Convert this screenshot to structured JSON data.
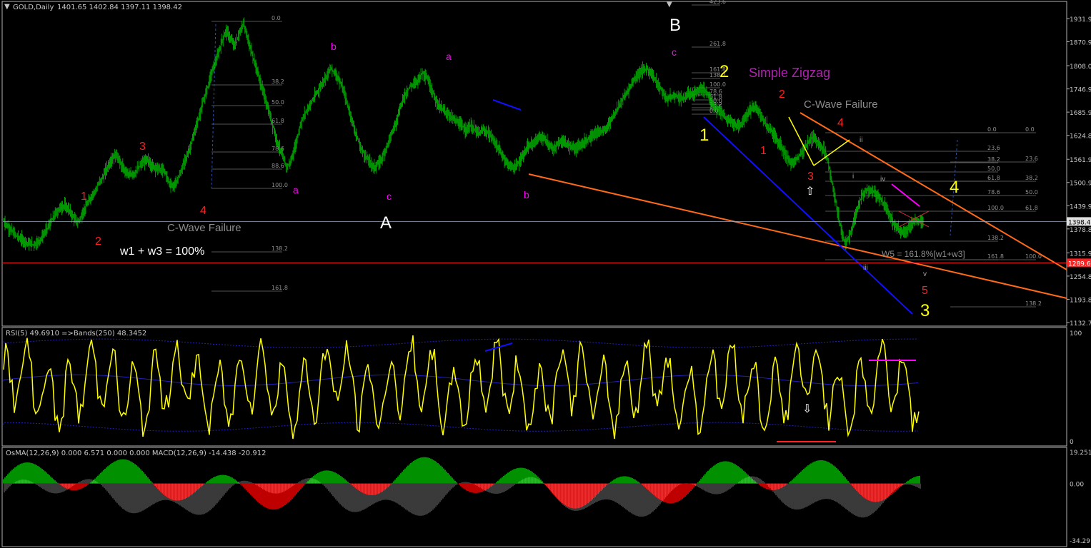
{
  "header": {
    "symbol": "GOLD,Daily",
    "ohlc": "1401.65 1402.84 1397.11 1398.42"
  },
  "colors": {
    "background": "#000000",
    "candles": "#00c000",
    "rsi_line": "#ffff00",
    "macd_signal": "#c0c0c0",
    "osma_up": "#00c000",
    "osma_down": "#ff0000",
    "wave_red": "#ff2020",
    "wave_yellow": "#ffff00",
    "wave_magenta": "#ff00ff",
    "wave_white": "#ffffff",
    "channel_orange": "#ff6a1a",
    "channel_blue": "#1010ff",
    "fib_lines": "#707070"
  },
  "chart_data": [
    {
      "type": "candlestick",
      "panel": "price",
      "y_ticks": [
        "1931.9",
        "1870.9",
        "1808.0",
        "1746.9",
        "1685.9",
        "1624.8",
        "1561.9",
        "1500.9",
        "1439.9",
        "1378.8",
        "1315.9",
        "1254.8",
        "1193.8",
        "1132.7"
      ],
      "ylim": [
        1110,
        1960
      ],
      "current_price": "1398.4",
      "horizontal_line_value": "1289.6",
      "close_series": [
        1400,
        1385,
        1372,
        1360,
        1352,
        1345,
        1340,
        1338,
        1345,
        1360,
        1380,
        1400,
        1420,
        1435,
        1440,
        1430,
        1410,
        1395,
        1415,
        1440,
        1460,
        1480,
        1500,
        1520,
        1545,
        1565,
        1575,
        1545,
        1530,
        1520,
        1525,
        1540,
        1555,
        1560,
        1545,
        1540,
        1535,
        1530,
        1500,
        1490,
        1510,
        1540,
        1570,
        1600,
        1640,
        1680,
        1720,
        1760,
        1800,
        1830,
        1870,
        1900,
        1880,
        1860,
        1890,
        1920,
        1880,
        1840,
        1800,
        1760,
        1720,
        1680,
        1640,
        1600,
        1570,
        1540,
        1560,
        1600,
        1650,
        1680,
        1700,
        1720,
        1740,
        1760,
        1780,
        1800,
        1790,
        1770,
        1740,
        1700,
        1660,
        1620,
        1590,
        1570,
        1555,
        1540,
        1550,
        1570,
        1600,
        1630,
        1660,
        1700,
        1730,
        1750,
        1760,
        1770,
        1790,
        1780,
        1750,
        1720,
        1700,
        1690,
        1680,
        1670,
        1660,
        1650,
        1640,
        1650,
        1640,
        1630,
        1640,
        1630,
        1620,
        1600,
        1580,
        1560,
        1545,
        1540,
        1550,
        1570,
        1590,
        1600,
        1610,
        1620,
        1615,
        1600,
        1590,
        1600,
        1610,
        1605,
        1595,
        1590,
        1600,
        1605,
        1615,
        1625,
        1630,
        1635,
        1640,
        1660,
        1680,
        1700,
        1720,
        1740,
        1760,
        1780,
        1790,
        1800,
        1795,
        1780,
        1760,
        1740,
        1720,
        1725,
        1730,
        1725,
        1720,
        1735,
        1730,
        1740,
        1745,
        1740,
        1720,
        1700,
        1690,
        1680,
        1665,
        1660,
        1650,
        1655,
        1670,
        1690,
        1700,
        1690,
        1670,
        1650,
        1640,
        1620,
        1600,
        1580,
        1560,
        1550,
        1565,
        1580,
        1600,
        1615,
        1620,
        1600,
        1590,
        1560,
        1500,
        1440,
        1380,
        1340,
        1360,
        1400,
        1440,
        1470,
        1480,
        1480,
        1470,
        1460,
        1440,
        1420,
        1395,
        1380,
        1370,
        1375,
        1390,
        1400,
        1398
      ],
      "wave_labels": [
        {
          "text": "1",
          "color": "red"
        },
        {
          "text": "2",
          "color": "red"
        },
        {
          "text": "3",
          "color": "red"
        },
        {
          "text": "4",
          "color": "red"
        },
        {
          "text": "a",
          "color": "magenta"
        },
        {
          "text": "b",
          "color": "magenta"
        },
        {
          "text": "c",
          "color": "magenta"
        },
        {
          "text": "a",
          "color": "magenta"
        },
        {
          "text": "b",
          "color": "magenta"
        },
        {
          "text": "c",
          "color": "magenta"
        },
        {
          "text": "A",
          "color": "white"
        },
        {
          "text": "B",
          "color": "white"
        },
        {
          "text": "1",
          "color": "yellow"
        },
        {
          "text": "2",
          "color": "yellow"
        },
        {
          "text": "3",
          "color": "yellow"
        },
        {
          "text": "4",
          "color": "yellow"
        },
        {
          "text": "1",
          "color": "red"
        },
        {
          "text": "2",
          "color": "red"
        },
        {
          "text": "3",
          "color": "red"
        },
        {
          "text": "4",
          "color": "red"
        },
        {
          "text": "5",
          "color": "red"
        },
        {
          "text": "i",
          "color": "gray"
        },
        {
          "text": "ii",
          "color": "gray"
        },
        {
          "text": "iii",
          "color": "gray"
        },
        {
          "text": "iv",
          "color": "gray"
        },
        {
          "text": "v",
          "color": "gray"
        }
      ],
      "annotations": {
        "c_wave_failure_1": "C-Wave Failure",
        "w1_w3": "w1 + w3 = 100%",
        "simple_zigzag": "Simple Zigzag",
        "c_wave_failure_2": "C-Wave Failure",
        "w5": "W5 = 161.8%[w1+w3]"
      },
      "fib_levels_left": [
        "0.0",
        "38.2",
        "50.0",
        "61.8",
        "78.6",
        "88.6",
        "100.0",
        "138.2",
        "161.8"
      ],
      "fib_levels_center": [
        "423.6",
        "261.8",
        "161.8",
        "138.2",
        "100.0",
        "78.6",
        "61.8",
        "50.0",
        "38.2",
        "23.6",
        "0.0"
      ],
      "fib_levels_right_a": [
        "0.0",
        "23.6",
        "38.2",
        "50.0",
        "61.8",
        "78.6",
        "100.0",
        "138.2",
        "161.8"
      ],
      "fib_levels_right_b": [
        "0.0",
        "23.6",
        "38.2",
        "50.0",
        "61.8",
        "100.0",
        "138.2"
      ]
    },
    {
      "type": "line",
      "panel": "rsi",
      "title": "RSI(5) 49.6910  =>Bands(250) 48.3452",
      "y_ticks": [
        "100",
        "0"
      ],
      "ylim": [
        0,
        100
      ]
    },
    {
      "type": "bar",
      "panel": "osma_macd",
      "title": "OsMA(12,26,9) 0.000 6.571 0.000 0.000  MACD(12,26,9) -14.438 -20.912",
      "y_ticks": [
        "19.251",
        "0.00",
        "-34.291"
      ],
      "ylim": [
        -34.291,
        19.251
      ]
    }
  ]
}
